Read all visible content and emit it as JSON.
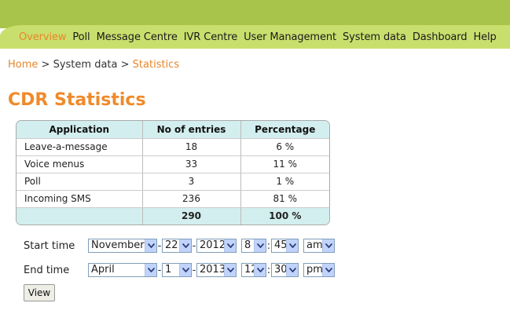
{
  "nav": {
    "items": [
      {
        "label": "Overview",
        "active": true
      },
      {
        "label": "Poll"
      },
      {
        "label": "Message Centre"
      },
      {
        "label": "IVR Centre"
      },
      {
        "label": "User Management"
      },
      {
        "label": "System data"
      },
      {
        "label": "Dashboard"
      },
      {
        "label": "Help"
      }
    ]
  },
  "breadcrumb": {
    "home": "Home",
    "sep1": ">",
    "middle": "System data",
    "sep2": ">",
    "current": "Statistics"
  },
  "page": {
    "title": "CDR Statistics"
  },
  "table": {
    "headers": [
      "Application",
      "No of entries",
      "Percentage"
    ],
    "rows": [
      [
        "Leave-a-message",
        "18",
        "6 %"
      ],
      [
        "Voice menus",
        "33",
        "11 %"
      ],
      [
        "Poll",
        "3",
        "1 %"
      ],
      [
        "Incoming SMS",
        "236",
        "81 %"
      ]
    ],
    "total": [
      "",
      "290",
      "100 %"
    ]
  },
  "start_time": {
    "label": "Start time",
    "month": "November",
    "day": "22",
    "year": "2012",
    "hour": "8",
    "minute": "45",
    "ampm": "am"
  },
  "end_time": {
    "label": "End time",
    "month": "April",
    "day": "1",
    "year": "2013",
    "hour": "12",
    "minute": "30",
    "ampm": "pm"
  },
  "view_button": {
    "label": "View"
  },
  "colors": {
    "top_band": "#a9c44a",
    "nav_band": "#c9df6d",
    "accent": "#ef8a2a",
    "table_header": "#d3eeee"
  }
}
